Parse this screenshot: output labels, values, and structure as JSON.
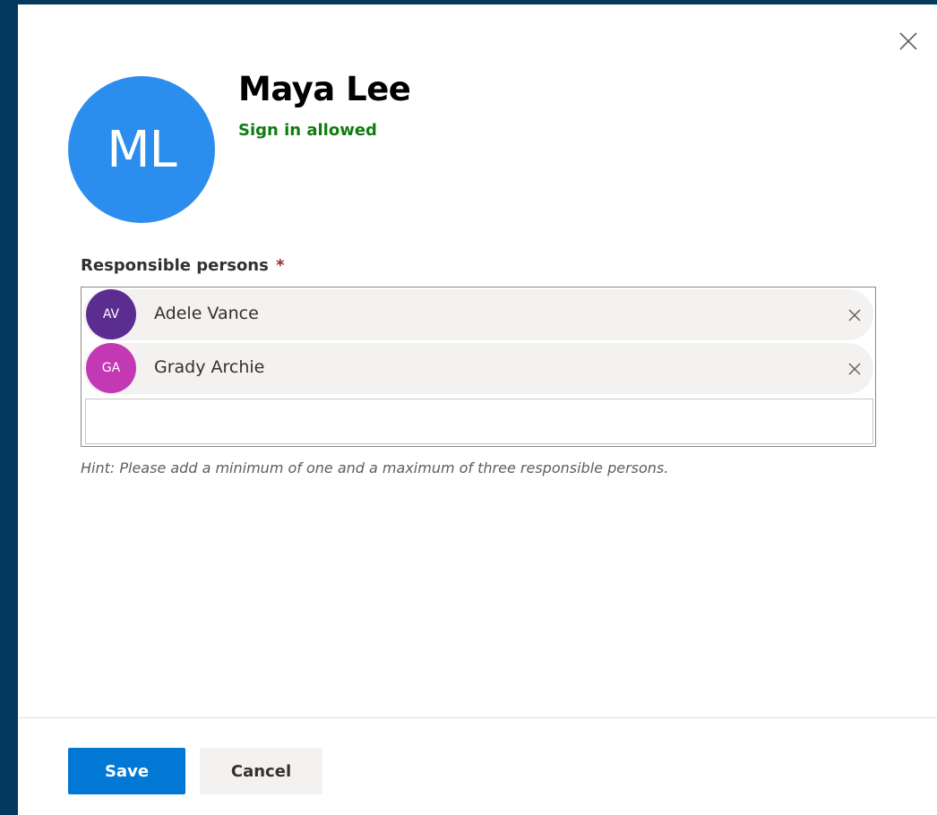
{
  "dialog": {
    "close_icon": "close-icon"
  },
  "user": {
    "initials": "ML",
    "name": "Maya Lee",
    "status": "Sign in allowed",
    "status_color": "#107c10",
    "avatar_color": "#2b8ded"
  },
  "field": {
    "label": "Responsible persons",
    "required_marker": "*",
    "input_value": "",
    "hint": "Hint: Please add a minimum of one and a maximum of three responsible persons."
  },
  "personas": [
    {
      "initials": "AV",
      "name": "Adele Vance",
      "color": "#5c2d91",
      "remove_icon": "close-icon"
    },
    {
      "initials": "GA",
      "name": "Grady Archie",
      "color": "#c239b3",
      "remove_icon": "close-icon"
    }
  ],
  "footer": {
    "save_label": "Save",
    "cancel_label": "Cancel",
    "primary_color": "#0078d4"
  },
  "colors": {
    "backdrop": "#03395e",
    "required": "#a4262c"
  }
}
